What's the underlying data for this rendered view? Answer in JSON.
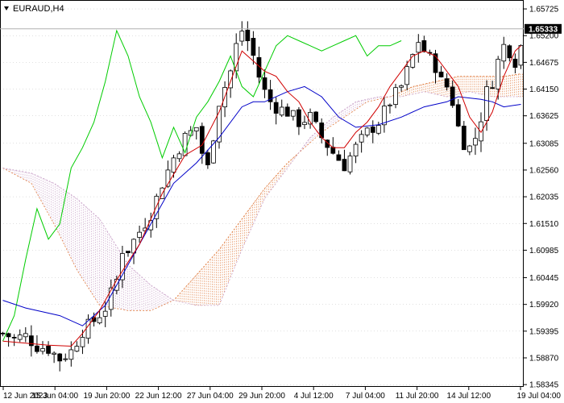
{
  "chart_data": {
    "type": "candlestick",
    "title": "EURAUD,H4",
    "symbol": "EURAUD",
    "timeframe": "H4",
    "current_price": "1.65333",
    "ylim": [
      1.583,
      1.659
    ],
    "y_ticks": [
      "1.65725",
      "1.65200",
      "1.64675",
      "1.64150",
      "1.63625",
      "1.63085",
      "1.62560",
      "1.62035",
      "1.61510",
      "1.60985",
      "1.60445",
      "1.59920",
      "1.59395",
      "1.58870",
      "1.58345"
    ],
    "x_labels": [
      "12 Jun 2023",
      "15 Jun 04:00",
      "19 Jun 20:00",
      "22 Jun 12:00",
      "27 Jun 04:00",
      "29 Jun 20:00",
      "4 Jul 12:00",
      "7 Jul 04:00",
      "11 Jul 20:00",
      "14 Jul 12:00",
      "19 Jul 04:00"
    ],
    "colors": {
      "bull_body": "#ffffff",
      "bear_body": "#000000",
      "candle_line": "#000000",
      "tenkan": "#d00000",
      "kijun": "#0000c8",
      "chikou": "#00cc00",
      "kumo_bull": "#e07a3c",
      "kumo_bear": "#c8a0c8",
      "grid": "#c0c0c0",
      "price_label_bg": "#000000"
    },
    "close_path": [
      [
        0,
        1.5935
      ],
      [
        2,
        1.5925
      ],
      [
        4,
        1.593
      ],
      [
        6,
        1.591
      ],
      [
        8,
        1.5905
      ],
      [
        10,
        1.5885
      ],
      [
        12,
        1.59
      ],
      [
        14,
        1.594
      ],
      [
        16,
        1.596
      ],
      [
        18,
        1.5985
      ],
      [
        20,
        1.604
      ],
      [
        21,
        1.61
      ],
      [
        22,
        1.61
      ],
      [
        24,
        1.6135
      ],
      [
        26,
        1.617
      ],
      [
        28,
        1.623
      ],
      [
        30,
        1.628
      ],
      [
        32,
        1.632
      ],
      [
        34,
        1.634
      ],
      [
        35,
        1.629
      ],
      [
        36,
        1.626
      ],
      [
        38,
        1.639
      ],
      [
        40,
        1.645
      ],
      [
        41,
        1.65
      ],
      [
        42,
        1.653
      ],
      [
        43,
        1.651
      ],
      [
        44,
        1.648
      ],
      [
        45,
        1.644
      ],
      [
        46,
        1.641
      ],
      [
        47,
        1.639
      ],
      [
        48,
        1.638
      ],
      [
        50,
        1.637
      ],
      [
        52,
        1.635
      ],
      [
        54,
        1.636
      ],
      [
        56,
        1.632
      ],
      [
        58,
        1.629
      ],
      [
        60,
        1.6265
      ],
      [
        62,
        1.63
      ],
      [
        64,
        1.633
      ],
      [
        66,
        1.635
      ],
      [
        68,
        1.639
      ],
      [
        70,
        1.642
      ],
      [
        72,
        1.648
      ],
      [
        73,
        1.651
      ],
      [
        74,
        1.649
      ],
      [
        76,
        1.646
      ],
      [
        77,
        1.643
      ],
      [
        78,
        1.642
      ],
      [
        79,
        1.639
      ],
      [
        80,
        1.634
      ],
      [
        81,
        1.631
      ],
      [
        82,
        1.63
      ],
      [
        83,
        1.632
      ],
      [
        84,
        1.636
      ],
      [
        85,
        1.641
      ],
      [
        86,
        1.643
      ],
      [
        87,
        1.647
      ],
      [
        88,
        1.65
      ],
      [
        89,
        1.649
      ],
      [
        90,
        1.647
      ],
      [
        91,
        1.65
      ]
    ],
    "tenkan_sen": [
      [
        0,
        1.592
      ],
      [
        8,
        1.5912
      ],
      [
        12,
        1.591
      ],
      [
        14,
        1.5935
      ],
      [
        17,
        1.598
      ],
      [
        20,
        1.604
      ],
      [
        24,
        1.611
      ],
      [
        28,
        1.621
      ],
      [
        32,
        1.6285
      ],
      [
        35,
        1.6305
      ],
      [
        38,
        1.637
      ],
      [
        40,
        1.643
      ],
      [
        42,
        1.649
      ],
      [
        44,
        1.647
      ],
      [
        46,
        1.645
      ],
      [
        48,
        1.644
      ],
      [
        50,
        1.641
      ],
      [
        52,
        1.639
      ],
      [
        54,
        1.635
      ],
      [
        56,
        1.632
      ],
      [
        58,
        1.63
      ],
      [
        60,
        1.63
      ],
      [
        62,
        1.633
      ],
      [
        64,
        1.635
      ],
      [
        66,
        1.638
      ],
      [
        68,
        1.642
      ],
      [
        70,
        1.645
      ],
      [
        72,
        1.648
      ],
      [
        74,
        1.649
      ],
      [
        76,
        1.648
      ],
      [
        78,
        1.645
      ],
      [
        80,
        1.642
      ],
      [
        82,
        1.636
      ],
      [
        84,
        1.633
      ],
      [
        86,
        1.637
      ],
      [
        88,
        1.644
      ],
      [
        90,
        1.649
      ],
      [
        91,
        1.65
      ]
    ],
    "kijun_sen": [
      [
        0,
        1.6
      ],
      [
        4,
        1.5985
      ],
      [
        10,
        1.597
      ],
      [
        14,
        1.595
      ],
      [
        18,
        1.599
      ],
      [
        22,
        1.607
      ],
      [
        26,
        1.615
      ],
      [
        30,
        1.623
      ],
      [
        34,
        1.627
      ],
      [
        38,
        1.632
      ],
      [
        42,
        1.638
      ],
      [
        44,
        1.639
      ],
      [
        46,
        1.639
      ],
      [
        50,
        1.641
      ],
      [
        53,
        1.642
      ],
      [
        56,
        1.64
      ],
      [
        59,
        1.636
      ],
      [
        62,
        1.634
      ],
      [
        66,
        1.6345
      ],
      [
        70,
        1.636
      ],
      [
        74,
        1.638
      ],
      [
        78,
        1.639
      ],
      [
        80,
        1.64
      ],
      [
        84,
        1.6395
      ],
      [
        86,
        1.639
      ],
      [
        88,
        1.638
      ],
      [
        91,
        1.6385
      ]
    ],
    "chikou_span": [
      [
        0,
        1.592
      ],
      [
        2,
        1.597
      ],
      [
        4,
        1.608
      ],
      [
        6,
        1.618
      ],
      [
        8,
        1.612
      ],
      [
        10,
        1.615
      ],
      [
        12,
        1.626
      ],
      [
        14,
        1.63
      ],
      [
        16,
        1.635
      ],
      [
        18,
        1.643
      ],
      [
        20,
        1.653
      ],
      [
        22,
        1.648
      ],
      [
        24,
        1.64
      ],
      [
        26,
        1.635
      ],
      [
        28,
        1.628
      ],
      [
        30,
        1.634
      ],
      [
        32,
        1.629
      ],
      [
        34,
        1.636
      ],
      [
        36,
        1.639
      ],
      [
        38,
        1.643
      ],
      [
        40,
        1.648
      ],
      [
        42,
        1.642
      ],
      [
        44,
        1.64
      ],
      [
        46,
        1.645
      ],
      [
        48,
        1.65
      ],
      [
        50,
        1.652
      ],
      [
        52,
        1.651
      ],
      [
        54,
        1.65
      ],
      [
        56,
        1.649
      ],
      [
        58,
        1.65
      ],
      [
        60,
        1.651
      ],
      [
        62,
        1.652
      ],
      [
        64,
        1.648
      ],
      [
        66,
        1.65
      ],
      [
        68,
        1.65
      ],
      [
        70,
        1.651
      ]
    ],
    "senkou_span_a": [
      [
        0,
        1.626
      ],
      [
        5,
        1.623
      ],
      [
        9,
        1.615
      ],
      [
        13,
        1.606
      ],
      [
        17,
        1.599
      ],
      [
        22,
        1.598
      ],
      [
        26,
        1.598
      ],
      [
        30,
        1.6
      ],
      [
        34,
        1.605
      ],
      [
        38,
        1.61
      ],
      [
        42,
        1.616
      ],
      [
        46,
        1.622
      ],
      [
        50,
        1.627
      ],
      [
        53,
        1.63
      ],
      [
        56,
        1.633
      ],
      [
        60,
        1.636
      ],
      [
        64,
        1.639
      ],
      [
        68,
        1.64
      ],
      [
        72,
        1.642
      ],
      [
        76,
        1.643
      ],
      [
        80,
        1.644
      ],
      [
        84,
        1.644
      ],
      [
        88,
        1.644
      ],
      [
        91,
        1.6445
      ]
    ],
    "senkou_span_b": [
      [
        0,
        1.626
      ],
      [
        5,
        1.625
      ],
      [
        9,
        1.623
      ],
      [
        13,
        1.62
      ],
      [
        17,
        1.616
      ],
      [
        22,
        1.607
      ],
      [
        26,
        1.603
      ],
      [
        30,
        1.6
      ],
      [
        34,
        1.599
      ],
      [
        38,
        1.599
      ],
      [
        42,
        1.61
      ],
      [
        46,
        1.62
      ],
      [
        50,
        1.626
      ],
      [
        54,
        1.632
      ],
      [
        58,
        1.636
      ],
      [
        62,
        1.639
      ],
      [
        66,
        1.64
      ],
      [
        70,
        1.64
      ],
      [
        74,
        1.641
      ],
      [
        78,
        1.64
      ],
      [
        82,
        1.641
      ],
      [
        86,
        1.64
      ],
      [
        91,
        1.64
      ]
    ]
  }
}
